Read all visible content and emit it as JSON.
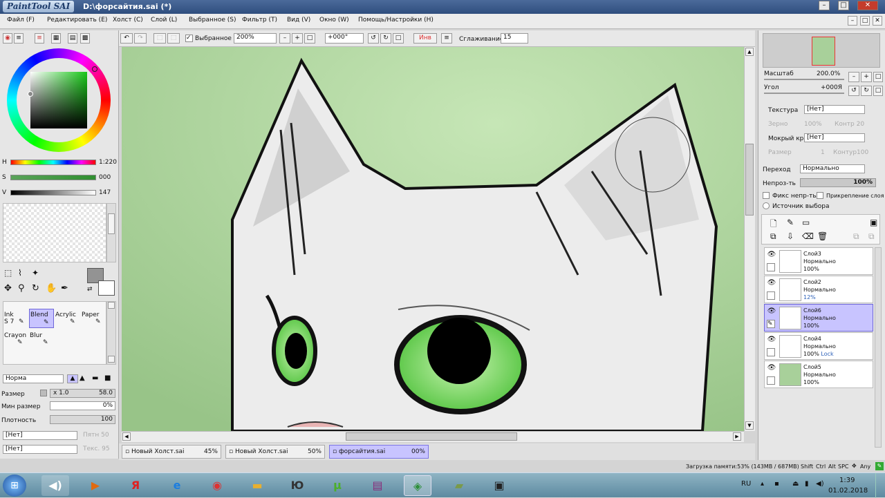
{
  "window": {
    "app_name": "PaintTool SAI",
    "title": "D:\\форсайтия.sai (*)",
    "min_icon": "minimize-icon",
    "max_icon": "maximize-icon",
    "close_icon": "close-icon"
  },
  "menu": [
    {
      "label": "Файл (F)"
    },
    {
      "label": "Редактировать (E)"
    },
    {
      "label": "Холст (C)"
    },
    {
      "label": "Слой (L)"
    },
    {
      "label": "Выбранное (S)"
    },
    {
      "label": "Фильтр (T)"
    },
    {
      "label": "Вид (V)"
    },
    {
      "label": "Окно (W)"
    },
    {
      "label": "Помощь/Настройки (H)"
    }
  ],
  "toolbar": {
    "selection_label": "Выбранное",
    "zoom_value": "200%",
    "angle_value": "+000°",
    "invert_label": "Инв",
    "smoothing_label": "Сглаживание",
    "smoothing_value": "15"
  },
  "color": {
    "h_label": "H",
    "s_label": "S",
    "v_label": "V",
    "h_value": "1:220",
    "s_value": "000",
    "v_value": "147"
  },
  "tools": [
    {
      "label": "Ink",
      "shortcut": "S 7"
    },
    {
      "label": "Blend"
    },
    {
      "label": "Acrylic"
    },
    {
      "label": "Paper"
    },
    {
      "label": "Crayon"
    },
    {
      "label": "Blur"
    }
  ],
  "brush": {
    "mode": "Норма",
    "size_label": "Размер",
    "size_multiplier": "x 1.0",
    "size_value": "58.0",
    "min_size_label": "Мин размер",
    "min_size_value": "0%",
    "density_label": "Плотность",
    "density_value": "100",
    "texture1": "[Нет]",
    "texture1_extra": "Пятн 50",
    "texture2": "[Нет]",
    "texture2_extra": "Текс. 95"
  },
  "navigator": {
    "zoom_label": "Масштаб",
    "zoom_value": "200.0%",
    "angle_label": "Угол",
    "angle_value": "+000Я"
  },
  "layer_props": {
    "texture_label": "Текстура",
    "texture_value": "[Нет]",
    "grain_label": "Зерно",
    "grain_value": "100%",
    "contrast_label": "Контр 20",
    "wet_edge_label": "Мокрый край",
    "wet_edge_value": "[Нет]",
    "size_label": "Размер",
    "size_value": "1",
    "contour_label": "Контур100",
    "blend_label": "Переход",
    "blend_value": "Нормально",
    "opacity_label": "Непроз-ть",
    "opacity_value": "100%",
    "opacity_fraction": 1.0,
    "fix_opacity_label": "Фикс непр-ть",
    "clip_label": "Прикрепление слоя",
    "selection_source_label": "Источник выбора"
  },
  "layers": [
    {
      "name": "Слой3",
      "mode": "Нормально",
      "opacity": "100%",
      "extra": "",
      "active": false
    },
    {
      "name": "Слой2",
      "mode": "Нормально",
      "opacity": "12%",
      "extra": "",
      "active": false
    },
    {
      "name": "Слой6",
      "mode": "Нормально",
      "opacity": "100%",
      "extra": "",
      "active": true
    },
    {
      "name": "Слой4",
      "mode": "Нормально",
      "opacity": "100%",
      "extra": "Lock",
      "active": false
    },
    {
      "name": "Слой5",
      "mode": "Нормально",
      "opacity": "100%",
      "extra": "",
      "active": false
    }
  ],
  "documents": [
    {
      "name": "Новый Холст.sai",
      "zoom": "45%"
    },
    {
      "name": "Новый Холст.sai",
      "zoom": "50%"
    },
    {
      "name": "форсайтия.sai",
      "zoom": "00%"
    }
  ],
  "status": {
    "memory": "Загрузка памяти:53% (143MB / 687MB)",
    "keys": [
      "Shift",
      "Ctrl",
      "Alt",
      "SPC",
      "Any"
    ]
  },
  "taskbar": {
    "lang": "RU",
    "time": "1:39",
    "date": "01.02.2018",
    "apps": [
      "start-orb-icon",
      "media-player-icon",
      "video-player-icon",
      "yandex-browser-icon",
      "internet-explorer-icon",
      "chrome-icon",
      "explorer-folder-icon",
      "uc-browser-icon",
      "utorrent-icon",
      "winrar-icon",
      "paint-app-icon",
      "image-viewer-icon",
      "video-editor-icon"
    ]
  },
  "colors": {
    "accent": "#c8c4ff",
    "canvas_bg": "#a8d09a",
    "eye_green": "#7ee06a"
  }
}
